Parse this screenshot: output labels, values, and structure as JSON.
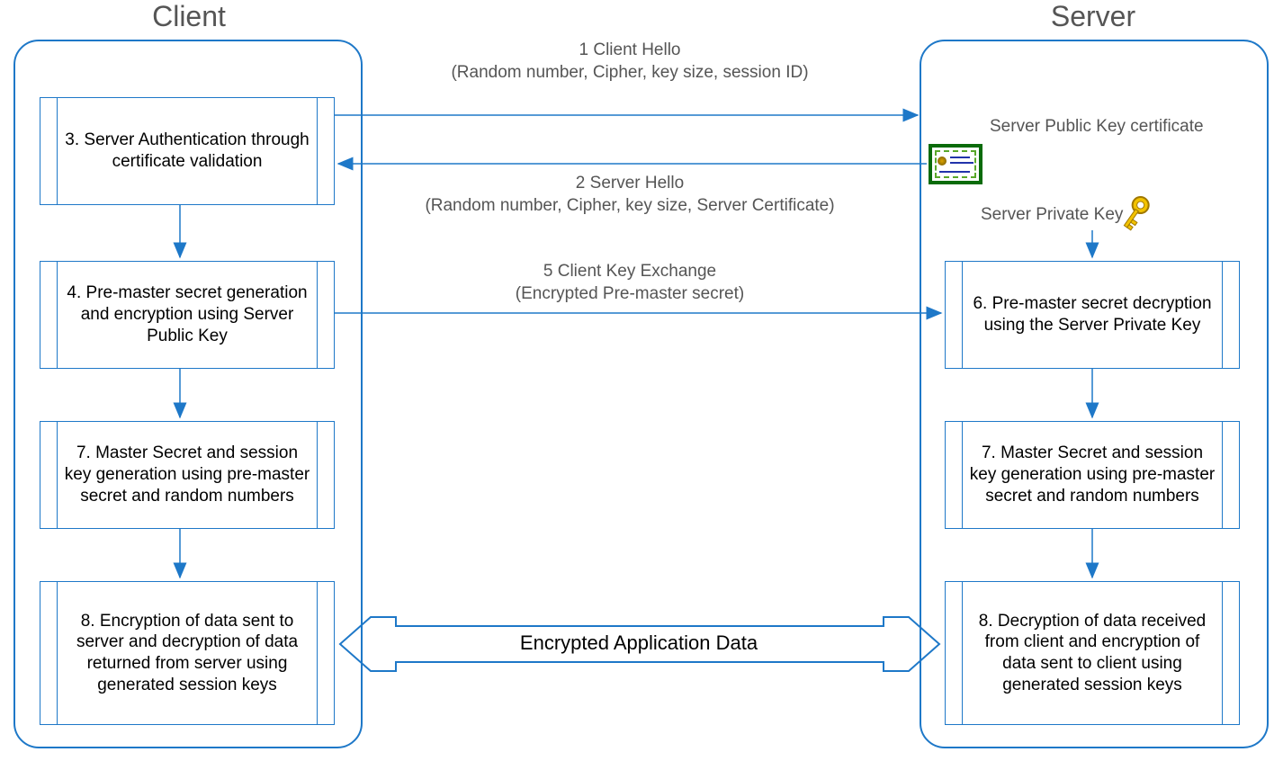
{
  "titles": {
    "client": "Client",
    "server": "Server"
  },
  "client_steps": {
    "s3": "3. Server Authentication through certificate validation",
    "s4": "4. Pre-master secret generation and encryption using Server Public Key",
    "s7": "7. Master Secret and session key generation using pre-master secret and random numbers",
    "s8": "8. Encryption of data sent to server and decryption of data returned from server using generated session keys"
  },
  "server_steps": {
    "s6": "6. Pre-master secret decryption using the Server Private Key",
    "s7": "7. Master Secret and session key generation using pre-master secret and random numbers",
    "s8": "8. Decryption of data received from client and encryption of data sent to client using generated session keys"
  },
  "messages": {
    "m1_title": "1 Client Hello",
    "m1_sub": "(Random number, Cipher, key size, session ID)",
    "m2_title": "2 Server Hello",
    "m2_sub": "(Random number, Cipher, key size, Server Certificate)",
    "m5_title": "5 Client Key Exchange",
    "m5_sub": "(Encrypted Pre-master secret)",
    "encrypted_data": "Encrypted Application Data"
  },
  "notes": {
    "server_cert": "Server Public Key certificate",
    "server_priv": "Server Private Key"
  },
  "icons": {
    "certificate": "certificate-icon",
    "key": "key-icon"
  },
  "colors": {
    "line": "#1e78c8",
    "text_muted": "#555555"
  }
}
